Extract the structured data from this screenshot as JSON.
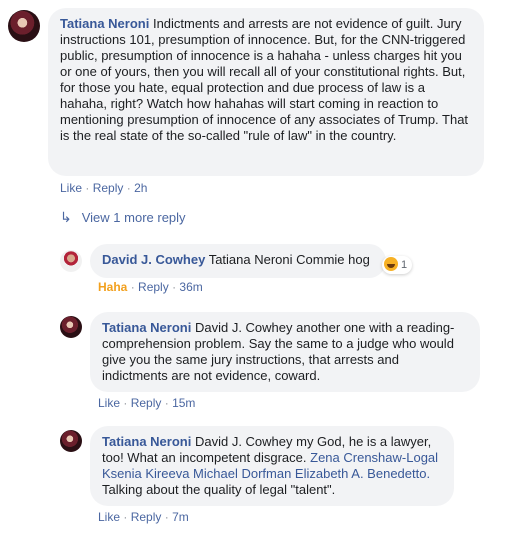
{
  "comments": [
    {
      "author": "Tatiana Neroni",
      "text": "Indictments and arrests are not evidence of guilt. Jury instructions 101, presumption of innocence. But, for the CNN-triggered public, presumption of innocence is a hahaha - unless charges hit you or one of yours, then you will recall all of your constitutional rights. But, for those you hate, equal protection and due process of law is a hahaha, right? Watch how hahahas will start coming in reaction to mentioning presumption of innocence of any associates of Trump. That is the real state of the so-called \"rule of law\" in the country.",
      "like": "Like",
      "reply": "Reply",
      "sep": "·",
      "time": "2h"
    }
  ],
  "view_more": {
    "label": "View 1 more reply",
    "icon": "reply-arrow-icon"
  },
  "replies": [
    {
      "author": "David J. Cowhey",
      "text": "Tatiana Neroni Commie hog",
      "reaction_count": "1",
      "reaction_icon": "haha-emoji-icon",
      "reacted": "Haha",
      "reply": "Reply",
      "sep": "·",
      "time": "36m"
    },
    {
      "author": "Tatiana Neroni",
      "text": "David J. Cowhey another one with a reading-comprehension problem. Say the same to a judge who would give you the same jury instructions, that arrests and indictments are not evidence, coward.",
      "like": "Like",
      "reply": "Reply",
      "sep": "·",
      "time": "15m"
    },
    {
      "author": "Tatiana Neroni",
      "text_before": "David J. Cowhey my God, he is a lawyer, too! What an incompetent disgrace.",
      "tags": "Zena Crenshaw-Logal Ksenia Kireeva Michael Dorfman Elizabeth A. Benedetto.",
      "text_after": "Talking about the quality of legal \"talent\".",
      "like": "Like",
      "reply": "Reply",
      "sep": "·",
      "time": "7m"
    }
  ],
  "colors": {
    "link": "#385898",
    "bubble": "#f2f3f5",
    "haha": "#f2a01e",
    "meta": "#90949c"
  }
}
